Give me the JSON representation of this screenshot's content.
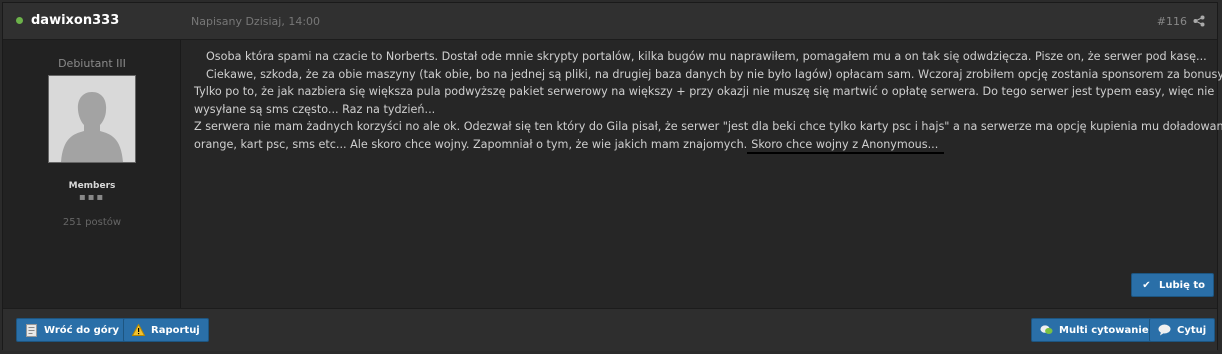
{
  "post": {
    "author": "dawixon333",
    "posted": "Napisany Dzisiaj, 14:00",
    "number": "#116"
  },
  "user": {
    "rank": "Debiutant III",
    "group": "Members",
    "pips": "▪▪▪",
    "post_count": "251 postów"
  },
  "content": {
    "line1": "Osoba która spami na czacie to Norberts. Dostał ode mnie skrypty portalów, kilka bugów mu naprawiłem, pomagałem mu a on tak się odwdzięcza. Pisze on, że serwer pod kasę...",
    "line2": "Ciekawe, szkoda, że za obie maszyny (tak obie, bo na jednej są pliki, na drugiej baza danych by nie było lagów) opłacam sam. Wczoraj zrobiłem opcję zostania sponsorem za bonusy.",
    "line3": "Tylko po to, że jak nazbiera się większa pula podwyższę pakiet serwerowy na większy + przy okazji nie muszę się martwić o opłatę serwera. Do tego serwer jest typem easy, więc nie",
    "line4": "wysyłane są sms często... Raz na tydzień...",
    "line5": "Z serwera nie mam żadnych korzyści no ale ok. Odezwał się ten który do Gila pisał, że serwer \"jest dla beki chce tylko karty psc i hajs\" a na serwerze ma opcję kupienia mu doładowania do",
    "line6": "orange, kart psc, sms etc... Ale skoro chce wojny. Zapomniał o tym, że wie jakich mam znajomych.",
    "highlight": "Skoro chce wojny z Anonymous..."
  },
  "buttons": {
    "like": "Lubię to",
    "back_top": "Wróć do góry",
    "report": "Raportuj",
    "multiquote": "Multi cytowanie",
    "quote": "Cytuj"
  },
  "icons": {
    "online": "online-indicator-icon",
    "share": "share-icon",
    "like": "checkmark-icon",
    "back_top": "page-icon",
    "report": "warning-icon",
    "multiquote": "chat-bubbles-icon",
    "quote": "speech-bubble-icon"
  },
  "colors": {
    "accent": "#2a6fa8",
    "online": "#6cb24a",
    "background": "#262626",
    "text": "#cfcfcf"
  }
}
